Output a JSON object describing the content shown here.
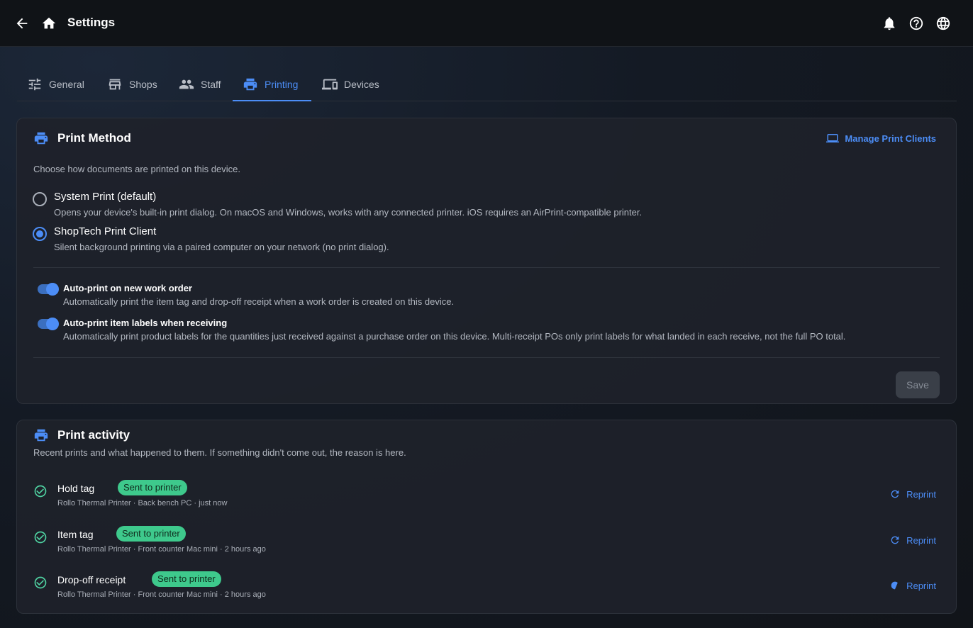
{
  "header": {
    "title": "Settings"
  },
  "tabs": [
    {
      "label": "General",
      "icon": "sliders-icon"
    },
    {
      "label": "Shops",
      "icon": "storefront-icon"
    },
    {
      "label": "Staff",
      "icon": "people-icon"
    },
    {
      "label": "Printing",
      "icon": "printer-icon",
      "active": true
    },
    {
      "label": "Devices",
      "icon": "devices-icon"
    }
  ],
  "print_method": {
    "title": "Print Method",
    "manage_label": "Manage Print Clients",
    "description": "Choose how documents are printed on this device.",
    "options": [
      {
        "label": "System Print (default)",
        "description": "Opens your device's built-in print dialog. On macOS and Windows, works with any connected printer. iOS requires an AirPrint-compatible printer.",
        "selected": false
      },
      {
        "label": "ShopTech Print Client",
        "description": "Silent background printing via a paired computer on your network (no print dialog).",
        "selected": true
      }
    ],
    "toggles": [
      {
        "label": "Auto-print on new work order",
        "description": "Automatically print the item tag and drop-off receipt when a work order is created on this device.",
        "on": true
      },
      {
        "label": "Auto-print item labels when receiving",
        "description": "Automatically print product labels for the quantities just received against a purchase order on this device. Multi-receipt POs only print labels for what landed in each receive, not the full PO total.",
        "on": true
      }
    ],
    "save_label": "Save"
  },
  "print_activity": {
    "title": "Print activity",
    "description": "Recent prints and what happened to them. If something didn't come out, the reason is here.",
    "reprint_label": "Reprint",
    "items": [
      {
        "name": "Hold tag",
        "status": "Sent to printer",
        "meta": "Rollo Thermal Printer · Back bench PC · just now"
      },
      {
        "name": "Item tag",
        "status": "Sent to printer",
        "meta": "Rollo Thermal Printer · Front counter Mac mini · 2 hours ago"
      },
      {
        "name": "Drop-off receipt",
        "status": "Sent to printer",
        "meta": "Rollo Thermal Printer · Front counter Mac mini · 2 hours ago"
      }
    ]
  },
  "colors": {
    "accent": "#4c8df6",
    "success": "#3ec98c",
    "background": "#111419"
  }
}
